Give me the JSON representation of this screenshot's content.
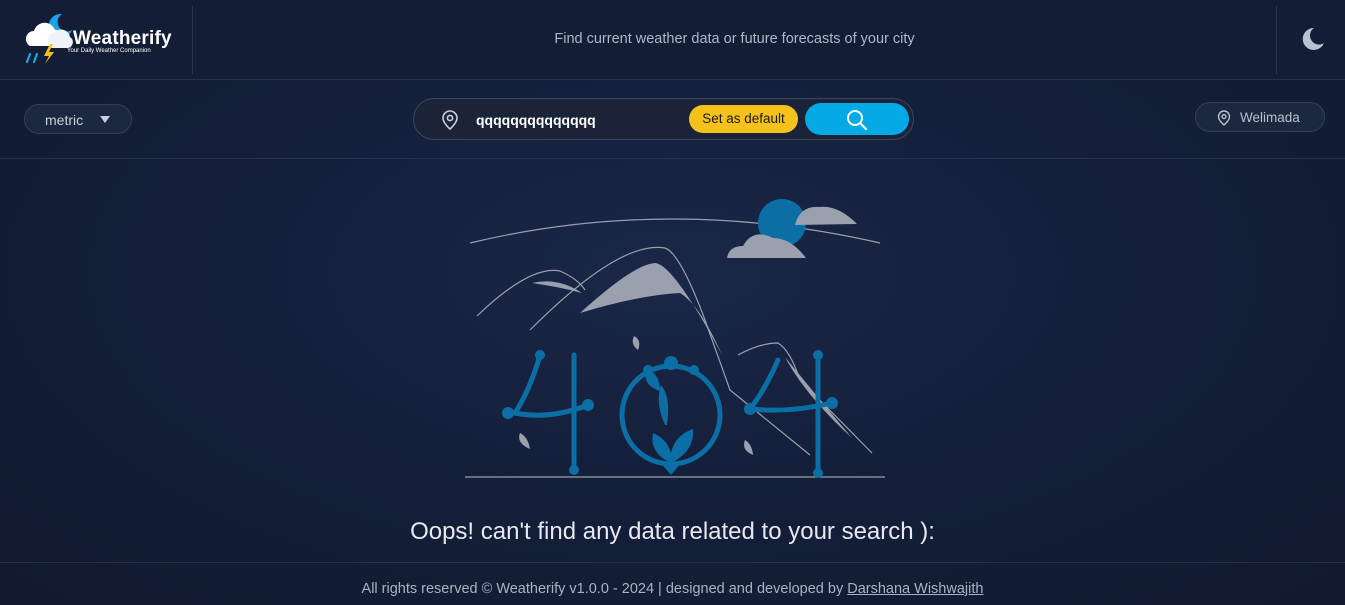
{
  "header": {
    "logo_title": "Weatherify",
    "logo_subtitle": "Your Daily Weather Companion",
    "tagline": "Find current weather data or future forecasts of your city",
    "theme_icon": "moon-icon"
  },
  "toolbar": {
    "units_value": "metric",
    "search_value": "qqqqqqqqqqqqqq",
    "set_default_label": "Set as default",
    "location_label": "Welimada"
  },
  "main": {
    "illustration_text": "404",
    "message": "Oops! can't find any data related to your search ):"
  },
  "footer": {
    "text": "All rights reserved © Weatherify v1.0.0 - 2024 | designed and developed by ",
    "author": "Darshana Wishwajith"
  },
  "colors": {
    "background": "#121c33",
    "accent_blue": "#04a9e6",
    "accent_yellow": "#f5c21b",
    "illustration_blue": "#0b6fa6",
    "illustration_gray": "#9aa0ad"
  }
}
